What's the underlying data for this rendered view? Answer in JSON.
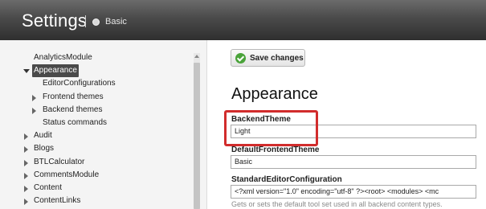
{
  "header": {
    "title": "Settings",
    "breadcrumb": "Basic"
  },
  "sidebar": {
    "items": [
      {
        "label": "AnalyticsModule",
        "level": 0,
        "state": "none"
      },
      {
        "label": "Appearance",
        "level": 0,
        "state": "expanded",
        "selected": true
      },
      {
        "label": "EditorConfigurations",
        "level": 1,
        "state": "none"
      },
      {
        "label": "Frontend themes",
        "level": 1,
        "state": "collapsed"
      },
      {
        "label": "Backend themes",
        "level": 1,
        "state": "collapsed"
      },
      {
        "label": "Status commands",
        "level": 1,
        "state": "none"
      },
      {
        "label": "Audit",
        "level": 0,
        "state": "collapsed"
      },
      {
        "label": "Blogs",
        "level": 0,
        "state": "collapsed"
      },
      {
        "label": "BTLCalculator",
        "level": 0,
        "state": "collapsed"
      },
      {
        "label": "CommentsModule",
        "level": 0,
        "state": "collapsed"
      },
      {
        "label": "Content",
        "level": 0,
        "state": "collapsed"
      },
      {
        "label": "ContentLinks",
        "level": 0,
        "state": "collapsed"
      }
    ]
  },
  "main": {
    "save_label": "Save changes",
    "heading": "Appearance",
    "fields": {
      "backend_theme": {
        "label": "BackendTheme",
        "value": "Light"
      },
      "default_frontend_theme": {
        "label": "DefaultFrontendTheme",
        "value": "Basic"
      },
      "standard_editor_configuration": {
        "label": "StandardEditorConfiguration",
        "value": "<?xml version=\"1.0\" encoding=\"utf-8\" ?><root>   <modules>        <mc"
      }
    },
    "help_text": "Gets or sets the default tool set used in all backend content types."
  },
  "colors": {
    "highlight": "#d12c2c",
    "header_dark": "#2f2f2f",
    "selected_bg": "#4a4a4a",
    "save_icon": "#4aa33a"
  }
}
